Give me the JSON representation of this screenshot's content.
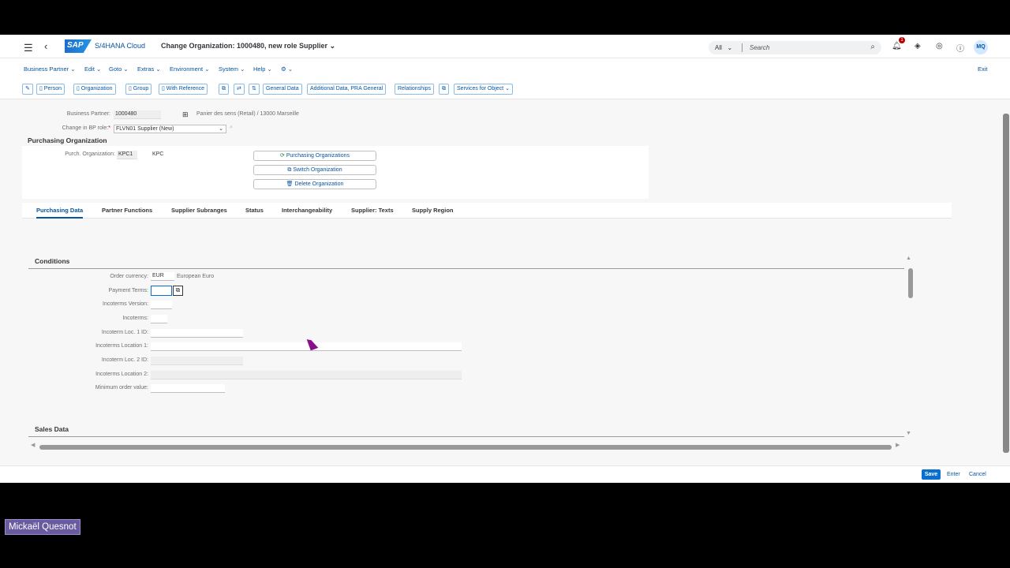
{
  "shell": {
    "product_name": "S/4HANA Cloud",
    "logo_text": "SAP",
    "app_title": "Change Organization: 1000480, new role Supplier",
    "search_scope": "All",
    "search_placeholder": "Search",
    "notification_count": "1",
    "avatar_initials": "MQ"
  },
  "menu": {
    "items": [
      "Business Partner",
      "Edit",
      "Goto",
      "Extras",
      "Environment",
      "System",
      "Help"
    ],
    "exit_label": "Exit"
  },
  "toolbar": {
    "person": "Person",
    "organization": "Organization",
    "group": "Group",
    "with_reference": "With Reference",
    "general_data": "General Data",
    "additional_data": "Additional Data, PRA General",
    "relationships": "Relationships",
    "services": "Services for Object"
  },
  "header": {
    "bp_label": "Business Partner:",
    "bp_value": "1000480",
    "bp_desc": "Panier des sens (Retail) / 13000 Marseille",
    "role_label": "Change in BP role:",
    "role_value": "FLVN01 Supplier (New)"
  },
  "purch_org": {
    "title": "Purchasing Organization",
    "label": "Purch. Organization:",
    "code": "KPC1",
    "name": "KPC",
    "btn_orgs": "Purchasing Organizations",
    "btn_switch": "Switch Organization",
    "btn_delete": "Delete Organization"
  },
  "tabs": [
    "Purchasing Data",
    "Partner Functions",
    "Supplier Subranges",
    "Status",
    "Interchangeability",
    "Supplier: Texts",
    "Supply Region"
  ],
  "conditions": {
    "title": "Conditions",
    "order_currency_label": "Order currency:",
    "order_currency": "EUR",
    "order_currency_desc": "European Euro",
    "payment_terms_label": "Payment Terms:",
    "incoterms_version_label": "Incoterms Version:",
    "incoterms_label": "Incoterms:",
    "inco_loc1_id_label": "Incoterm Loc. 1 ID:",
    "inco_loc1_label": "Incoterms Location 1:",
    "inco_loc2_id_label": "Incoterm Loc. 2 ID:",
    "inco_loc2_label": "Incoterms Location 2:",
    "min_order_label": "Minimum order value:"
  },
  "sales_data": {
    "title": "Sales Data"
  },
  "footer": {
    "save": "Save",
    "enter": "Enter",
    "cancel": "Cancel"
  },
  "presenter": {
    "name": "Mickaël Quesnot"
  }
}
